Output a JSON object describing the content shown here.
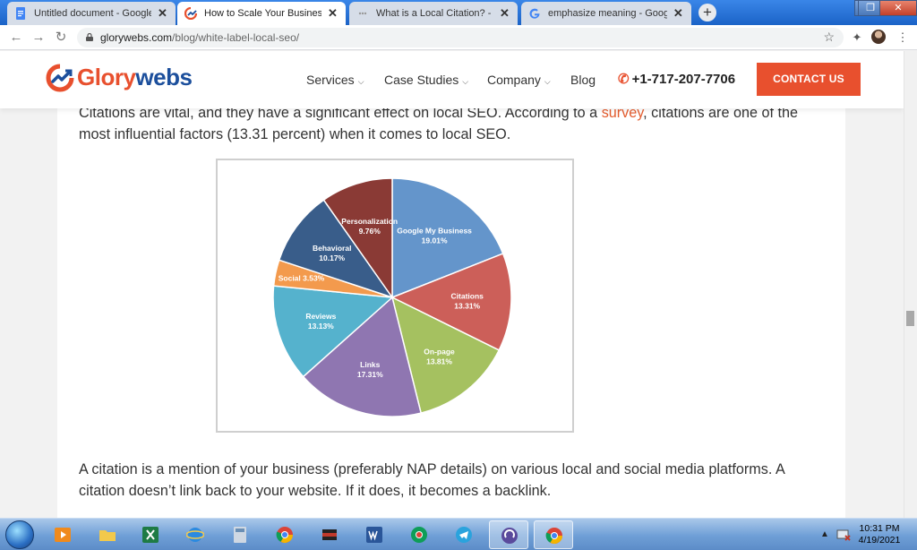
{
  "browser": {
    "tabs": [
      {
        "label": "Untitled document - Google Doc",
        "icon": "docs-icon",
        "active": false
      },
      {
        "label": "How to Scale Your Business with",
        "icon": "glorywebs-icon",
        "active": true
      },
      {
        "label": "What is a Local Citation? - White",
        "icon": "loading-icon",
        "active": false
      },
      {
        "label": "emphasize meaning - Google Se",
        "icon": "google-icon",
        "active": false
      }
    ],
    "close_glyph": "✕",
    "new_tab_glyph": "+",
    "url_host": "glorywebs.com",
    "url_path": "/blog/white-label-local-seo/"
  },
  "site": {
    "logo_part1": "Glory",
    "logo_part2": "webs",
    "nav": [
      {
        "label": "Services",
        "dropdown": true
      },
      {
        "label": "Case Studies",
        "dropdown": true
      },
      {
        "label": "Company",
        "dropdown": true
      },
      {
        "label": "Blog",
        "dropdown": false
      }
    ],
    "dropdown_glyph": "⌵",
    "phone": "+1-717-207-7706",
    "cta_label": "CONTACT US",
    "brand_orange": "#e8502e",
    "brand_blue": "#1c4f9c"
  },
  "article": {
    "para1_before_link": "Citations are vital, and they have a significant effect on local SEO. According to a ",
    "para1_link": "survey",
    "para1_line1_after": ", citations are one of the",
    "para1_line2": "most influential factors (13.31 percent) when it comes to local SEO.",
    "para2_line1": "A citation is a mention of your business (preferably NAP details) on various local and social media platforms. A",
    "para2_line2": "citation doesn’t link back to your website. If it does, it becomes a backlink."
  },
  "chart_data": {
    "type": "pie",
    "slices": [
      {
        "label": "Google My Business",
        "value": 19.01,
        "display": "19.01%",
        "color": "#6495cb"
      },
      {
        "label": "Citations",
        "value": 13.31,
        "display": "13.31%",
        "color": "#cc5f59"
      },
      {
        "label": "On-page",
        "value": 13.81,
        "display": "13.81%",
        "color": "#a5c160"
      },
      {
        "label": "Links",
        "value": 17.31,
        "display": "17.31%",
        "color": "#8f76b1"
      },
      {
        "label": "Reviews",
        "value": 13.13,
        "display": "13.13%",
        "color": "#55b2cd"
      },
      {
        "label": "Social",
        "value": 3.53,
        "display": "3.53%",
        "color": "#f39a4d"
      },
      {
        "label": "Behavioral",
        "value": 10.17,
        "display": "10.17%",
        "color": "#395d8a"
      },
      {
        "label": "Personalization",
        "value": 9.76,
        "display": "9.76%",
        "color": "#8a3a35"
      }
    ]
  },
  "taskbar": {
    "time": "10:31 PM",
    "date": "4/19/2021"
  }
}
